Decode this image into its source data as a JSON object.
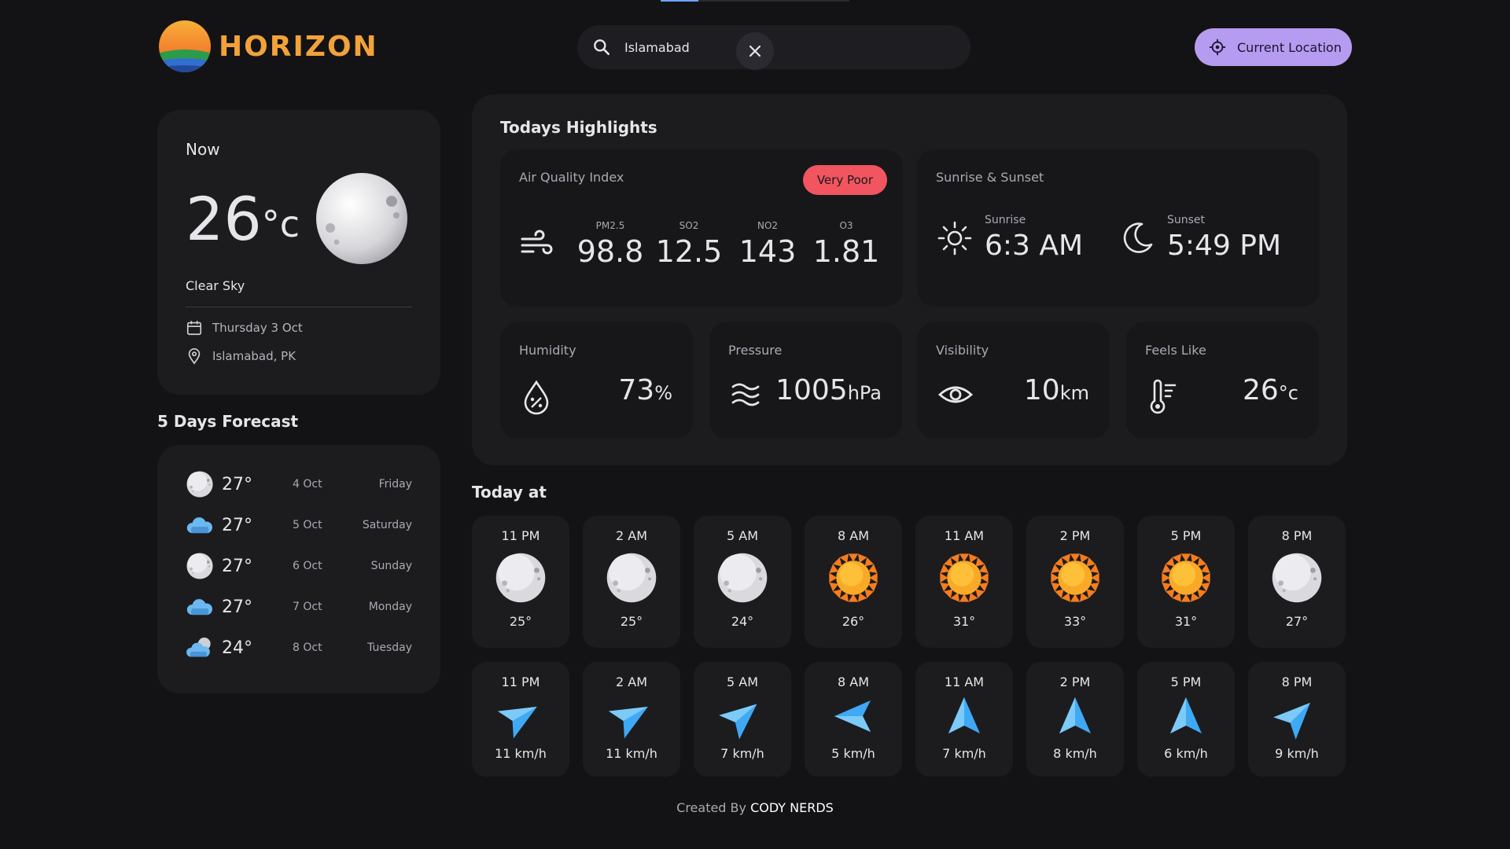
{
  "app": {
    "name": "HORIZON"
  },
  "search": {
    "value": "Islamabad"
  },
  "location_button": {
    "label": "Current Location"
  },
  "now": {
    "title": "Now",
    "temp": "26",
    "unit": "°c",
    "condition": "Clear Sky",
    "date": "Thursday 3 Oct",
    "location": "Islamabad, PK"
  },
  "forecast": {
    "title": "5 Days Forecast",
    "days": [
      {
        "icon": "moon-icon",
        "temp": "27°",
        "date": "4 Oct",
        "day": "Friday"
      },
      {
        "icon": "cloud-icon",
        "temp": "27°",
        "date": "5 Oct",
        "day": "Saturday"
      },
      {
        "icon": "moon-icon",
        "temp": "27°",
        "date": "6 Oct",
        "day": "Sunday"
      },
      {
        "icon": "cloud-icon",
        "temp": "27°",
        "date": "7 Oct",
        "day": "Monday"
      },
      {
        "icon": "cloud-moon-icon",
        "temp": "24°",
        "date": "8 Oct",
        "day": "Tuesday"
      }
    ]
  },
  "highlights": {
    "title": "Todays Highlights",
    "aqi": {
      "label": "Air Quality Index",
      "badge": "Very Poor",
      "badge_color": "#f05560",
      "pollutants": [
        {
          "name": "PM2.5",
          "value": "98.8"
        },
        {
          "name": "SO2",
          "value": "12.5"
        },
        {
          "name": "NO2",
          "value": "143"
        },
        {
          "name": "O3",
          "value": "1.81"
        }
      ]
    },
    "sun": {
      "label": "Sunrise & Sunset",
      "sunrise_label": "Sunrise",
      "sunrise": "6:3 AM",
      "sunset_label": "Sunset",
      "sunset": "5:49 PM"
    },
    "humidity": {
      "label": "Humidity",
      "value": "73",
      "unit": "%"
    },
    "pressure": {
      "label": "Pressure",
      "value": "1005",
      "unit": "hPa"
    },
    "visibility": {
      "label": "Visibility",
      "value": "10",
      "unit": "km"
    },
    "feels_like": {
      "label": "Feels Like",
      "value": "26",
      "unit": "°c"
    }
  },
  "today": {
    "title": "Today at",
    "hourly": [
      {
        "time": "11 PM",
        "icon": "moon-icon",
        "temp": "25°"
      },
      {
        "time": "2 AM",
        "icon": "moon-icon",
        "temp": "25°"
      },
      {
        "time": "5 AM",
        "icon": "moon-icon",
        "temp": "24°"
      },
      {
        "time": "8 AM",
        "icon": "sun-icon",
        "temp": "26°"
      },
      {
        "time": "11 AM",
        "icon": "sun-icon",
        "temp": "31°"
      },
      {
        "time": "2 PM",
        "icon": "sun-icon",
        "temp": "33°"
      },
      {
        "time": "5 PM",
        "icon": "sun-icon",
        "temp": "31°"
      },
      {
        "time": "8 PM",
        "icon": "moon-icon",
        "temp": "27°"
      }
    ],
    "wind": [
      {
        "time": "11 PM",
        "speed": "11 km/h",
        "direction_deg": 60
      },
      {
        "time": "2 AM",
        "speed": "11 km/h",
        "direction_deg": 60
      },
      {
        "time": "5 AM",
        "speed": "7 km/h",
        "direction_deg": 50
      },
      {
        "time": "8 AM",
        "speed": "5 km/h",
        "direction_deg": -90
      },
      {
        "time": "11 AM",
        "speed": "7 km/h",
        "direction_deg": 0
      },
      {
        "time": "2 PM",
        "speed": "8 km/h",
        "direction_deg": 0
      },
      {
        "time": "5 PM",
        "speed": "6 km/h",
        "direction_deg": 0
      },
      {
        "time": "8 PM",
        "speed": "9 km/h",
        "direction_deg": 45
      }
    ]
  },
  "footer": {
    "prefix": "Created By",
    "author": "CODY NERDS"
  }
}
